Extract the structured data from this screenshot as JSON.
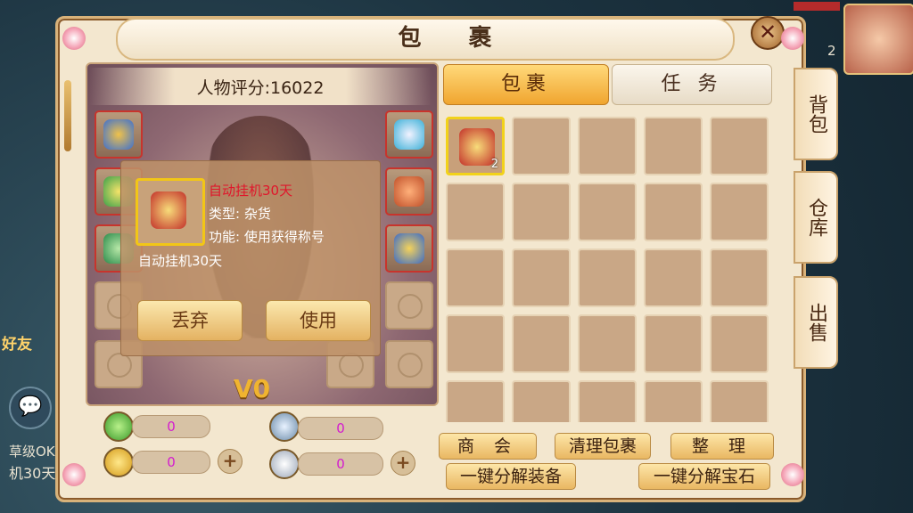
{
  "window": {
    "title": "包 裹",
    "close_icon": "close-icon"
  },
  "character": {
    "score_label": "人物评分:16022",
    "vip": "V0"
  },
  "tooltip": {
    "item_name": "自动挂机30天",
    "type_line": "类型: 杂货",
    "function_line": "功能: 使用获得称号",
    "description": "自动挂机30天",
    "discard_label": "丢弃",
    "use_label": "使用"
  },
  "currencies": [
    {
      "icon": "exp-icon",
      "value": "0"
    },
    {
      "icon": "sword-icon",
      "value": "0"
    },
    {
      "icon": "gold-ingot-icon",
      "value": "0"
    },
    {
      "icon": "silver-coin-icon",
      "value": "0"
    }
  ],
  "tabs": [
    {
      "label": "包裹",
      "active": true
    },
    {
      "label": "任 务",
      "active": false
    }
  ],
  "bag": {
    "first_item_count": "2"
  },
  "bottom_buttons": {
    "shop": "商 会",
    "clean": "清理包裹",
    "sort": "整 理",
    "decompose_equip": "一键分解装备",
    "decompose_gem": "一键分解宝石"
  },
  "side_tabs": [
    "背包",
    "仓库",
    "出售"
  ],
  "hud": {
    "friends": "好友",
    "fast_label": "草级OK",
    "bottom_text": "机30天",
    "level_number": "2"
  }
}
